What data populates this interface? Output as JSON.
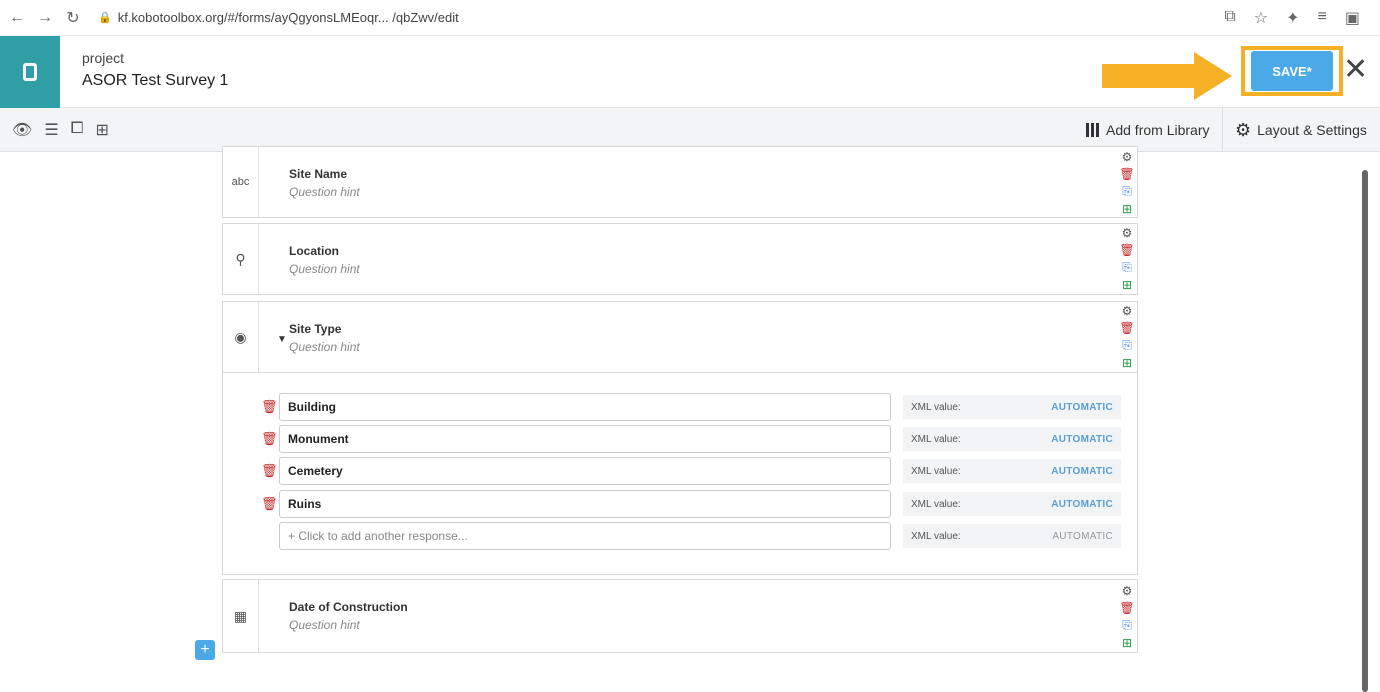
{
  "browser": {
    "url": "kf.kobotoolbox.org/#/forms/ayQgyonsLMEoqr... /qbZwv/edit"
  },
  "header": {
    "project_label": "project",
    "project_name": "ASOR Test Survey 1",
    "save_label": "SAVE*",
    "close_label": "✕"
  },
  "toolbar": {
    "add_library": "Add from Library",
    "layout_settings": "Layout & Settings"
  },
  "questions": [
    {
      "type_icon": "abc",
      "label": "Site Name",
      "hint": "Question hint"
    },
    {
      "type_icon": "⚲",
      "label": "Location",
      "hint": "Question hint"
    },
    {
      "type_icon": "◉",
      "label": "Site Type",
      "hint": "Question hint"
    },
    {
      "type_icon": "▦",
      "label": "Date of Construction",
      "hint": "Question hint"
    }
  ],
  "choices": [
    {
      "label": "Building",
      "xml_label": "XML value:",
      "xml_value": "AUTOMATIC"
    },
    {
      "label": "Monument",
      "xml_label": "XML value:",
      "xml_value": "AUTOMATIC"
    },
    {
      "label": "Cemetery",
      "xml_label": "XML value:",
      "xml_value": "AUTOMATIC"
    },
    {
      "label": "Ruins",
      "xml_label": "XML value:",
      "xml_value": "AUTOMATIC"
    }
  ],
  "add_choice": {
    "placeholder": "+ Click to add another response...",
    "xml_label": "XML value:",
    "xml_value": "AUTOMATIC"
  },
  "add_question": "+"
}
